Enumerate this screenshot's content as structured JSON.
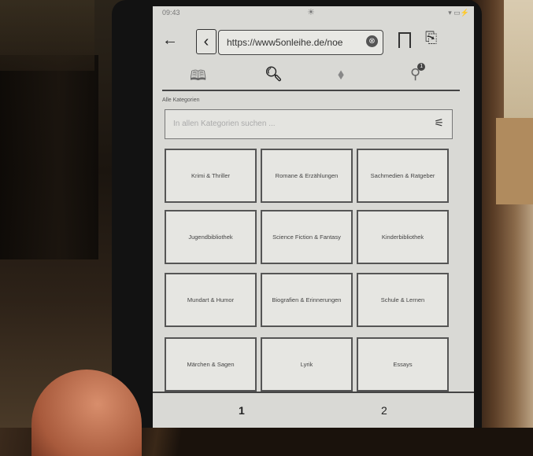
{
  "status": {
    "time": "09:43",
    "battery": "▾ ▭⚡"
  },
  "browser": {
    "url": "https://www5onleihe.de/noe",
    "url_clear_icon": "⊗"
  },
  "tabs": [
    {
      "name": "library-tab",
      "icon": "book-icon",
      "glyph": "🕮"
    },
    {
      "name": "search-tab",
      "icon": "search-icon",
      "glyph": "🔍︎"
    },
    {
      "name": "tags-tab",
      "icon": "tag-icon",
      "glyph": "⬧"
    },
    {
      "name": "account-tab",
      "icon": "user-icon",
      "glyph": "⚲",
      "badge": "1"
    }
  ],
  "categories": {
    "label": "Alle Kategorien",
    "search_placeholder": "In allen Kategorien suchen ...",
    "items": [
      "Krimi & Thriller",
      "Romane & Erzählungen",
      "Sachmedien & Ratgeber",
      "Jugendbibliothek",
      "Science Fiction & Fantasy",
      "Kinderbibliothek",
      "Mundart & Humor",
      "Biografien & Erinnerungen",
      "Schule & Lernen",
      "Märchen & Sagen",
      "Lyrik",
      "Essays"
    ]
  },
  "pagination": {
    "pages": [
      "1",
      "2"
    ]
  }
}
